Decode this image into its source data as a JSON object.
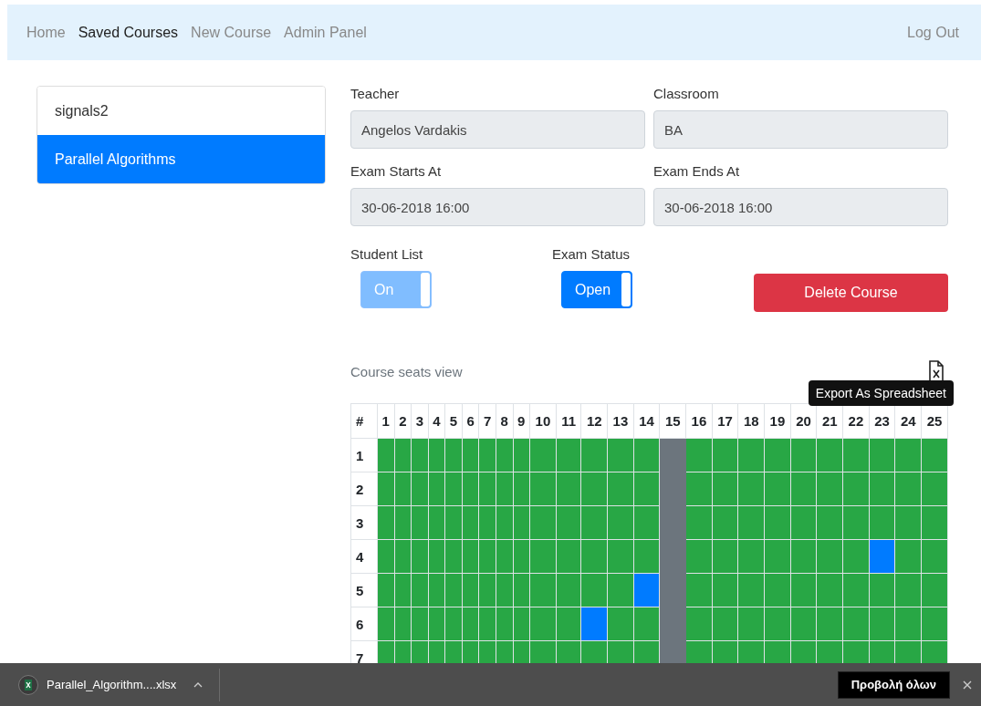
{
  "navbar": {
    "items": [
      {
        "label": "Home",
        "selected": false
      },
      {
        "label": "Saved Courses",
        "selected": true
      },
      {
        "label": "New Course",
        "selected": false
      },
      {
        "label": "Admin Panel",
        "selected": false
      }
    ],
    "logout": "Log Out"
  },
  "courses": [
    {
      "label": "signals2",
      "selected": false
    },
    {
      "label": "Parallel Algorithms",
      "selected": true
    }
  ],
  "fields": [
    {
      "label": "Teacher",
      "value": "Angelos Vardakis"
    },
    {
      "label": "Classroom",
      "value": "BA"
    },
    {
      "label": "Exam Starts At",
      "value": "30-06-2018 16:00"
    },
    {
      "label": "Exam Ends At",
      "value": "30-06-2018 16:00"
    }
  ],
  "toggles": [
    {
      "label": "Student List",
      "text": "On",
      "on": true,
      "disabled": true
    },
    {
      "label": "Exam Status",
      "text": "Open",
      "on": true,
      "disabled": false
    }
  ],
  "delete_button": "Delete Course",
  "seats": {
    "title": "Course seats view",
    "tooltip": "Export As Spreadsheet",
    "corner": "#",
    "columns": [
      {
        "label": "1",
        "disabled": false
      },
      {
        "label": "2",
        "disabled": false
      },
      {
        "label": "3",
        "disabled": false
      },
      {
        "label": "4",
        "disabled": false
      },
      {
        "label": "5",
        "disabled": false
      },
      {
        "label": "6",
        "disabled": false
      },
      {
        "label": "7",
        "disabled": false
      },
      {
        "label": "8",
        "disabled": false
      },
      {
        "label": "9",
        "disabled": false
      },
      {
        "label": "10",
        "disabled": false
      },
      {
        "label": "11",
        "disabled": false
      },
      {
        "label": "12",
        "disabled": false
      },
      {
        "label": "13",
        "disabled": false
      },
      {
        "label": "14",
        "disabled": false
      },
      {
        "label": "15",
        "disabled": true
      },
      {
        "label": "16",
        "disabled": false
      },
      {
        "label": "17",
        "disabled": false
      },
      {
        "label": "18",
        "disabled": false
      },
      {
        "label": "19",
        "disabled": false
      },
      {
        "label": "20",
        "disabled": false
      },
      {
        "label": "21",
        "disabled": false
      },
      {
        "label": "22",
        "disabled": false
      },
      {
        "label": "23",
        "disabled": false
      },
      {
        "label": "24",
        "disabled": false
      },
      {
        "label": "25",
        "disabled": false
      }
    ],
    "rows": [
      {
        "label": "1",
        "occupied": [
          false,
          false,
          false,
          false,
          false,
          false,
          false,
          false,
          false,
          false,
          false,
          false,
          false,
          false,
          false,
          false,
          false,
          false,
          false,
          false,
          false,
          false,
          false,
          false,
          false
        ]
      },
      {
        "label": "2",
        "occupied": [
          false,
          false,
          false,
          false,
          false,
          false,
          false,
          false,
          false,
          false,
          false,
          false,
          false,
          false,
          false,
          false,
          false,
          false,
          false,
          false,
          false,
          false,
          false,
          false,
          false
        ]
      },
      {
        "label": "3",
        "occupied": [
          false,
          false,
          false,
          false,
          false,
          false,
          false,
          false,
          false,
          false,
          false,
          false,
          false,
          false,
          false,
          false,
          false,
          false,
          false,
          false,
          false,
          false,
          false,
          false,
          false
        ]
      },
      {
        "label": "4",
        "occupied": [
          false,
          false,
          false,
          false,
          false,
          false,
          false,
          false,
          false,
          false,
          false,
          false,
          false,
          false,
          false,
          false,
          false,
          false,
          false,
          false,
          false,
          false,
          true,
          false,
          false
        ]
      },
      {
        "label": "5",
        "occupied": [
          false,
          false,
          false,
          false,
          false,
          false,
          false,
          false,
          false,
          false,
          false,
          false,
          false,
          true,
          false,
          false,
          false,
          false,
          false,
          false,
          false,
          false,
          false,
          false,
          false
        ]
      },
      {
        "label": "6",
        "occupied": [
          false,
          false,
          false,
          false,
          false,
          false,
          false,
          false,
          false,
          false,
          false,
          true,
          false,
          false,
          false,
          false,
          false,
          false,
          false,
          false,
          false,
          false,
          false,
          false,
          false
        ]
      },
      {
        "label": "7",
        "occupied": [
          false,
          false,
          false,
          false,
          false,
          false,
          false,
          false,
          false,
          false,
          false,
          false,
          false,
          false,
          false,
          false,
          false,
          false,
          false,
          false,
          false,
          false,
          false,
          false,
          false
        ]
      }
    ]
  },
  "download_bar": {
    "file": "Parallel_Algorithm....xlsx",
    "show_all": "Προβολή όλων"
  }
}
